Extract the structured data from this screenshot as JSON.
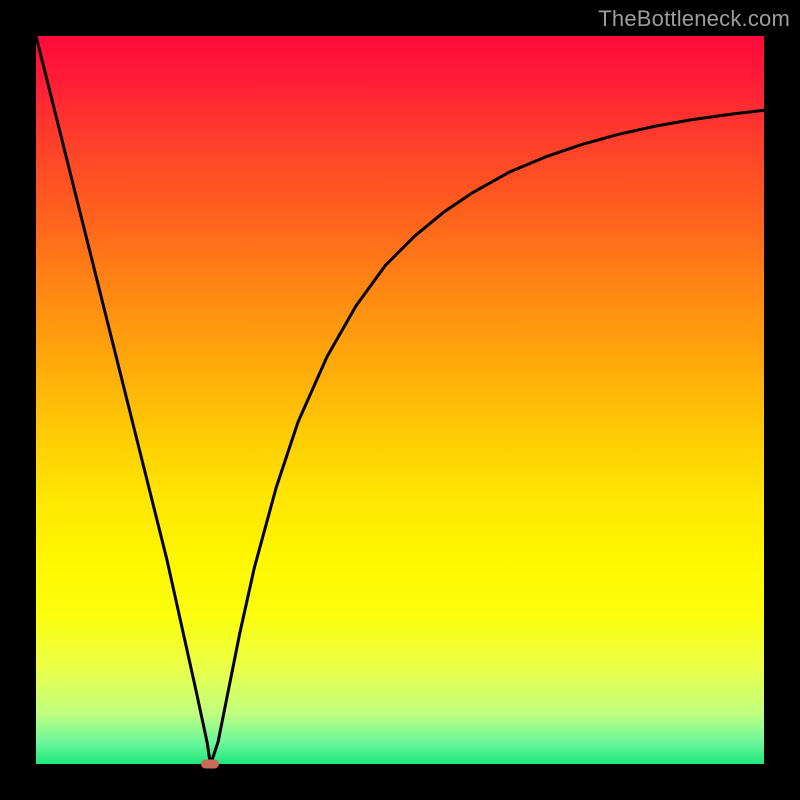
{
  "watermark": "TheBottleneck.com",
  "chart_data": {
    "type": "line",
    "title": "",
    "xlabel": "",
    "ylabel": "",
    "xlim": [
      0,
      100
    ],
    "ylim": [
      0,
      100
    ],
    "series": [
      {
        "name": "curve",
        "x": [
          0,
          2,
          4,
          6,
          8,
          10,
          12,
          14,
          16,
          18,
          20,
          22,
          23.5,
          23.8,
          24,
          25,
          26,
          28,
          30,
          33,
          36,
          40,
          44,
          48,
          52,
          56,
          60,
          65,
          70,
          75,
          80,
          85,
          90,
          95,
          100
        ],
        "y": [
          100,
          92,
          84,
          76,
          68,
          60,
          52,
          44,
          36,
          28,
          19,
          10,
          3,
          1,
          0,
          3,
          8,
          18,
          27,
          38,
          47,
          56,
          63,
          68.5,
          72.5,
          75.8,
          78.5,
          81.3,
          83.4,
          85.1,
          86.5,
          87.6,
          88.5,
          89.2,
          89.8
        ]
      }
    ],
    "marker": {
      "x": 23.9,
      "y": 0
    },
    "colors": {
      "curve": "#000000",
      "marker": "#c96a5c",
      "background": "#000000"
    }
  }
}
